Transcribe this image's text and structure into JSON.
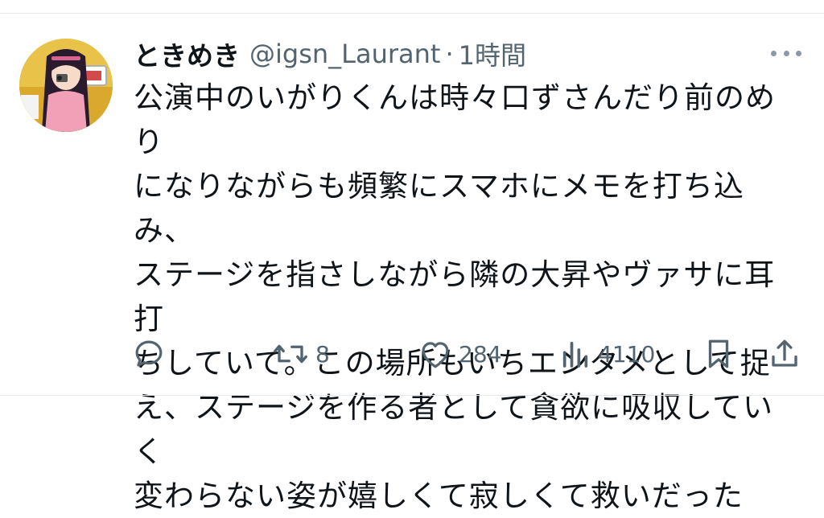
{
  "tweet": {
    "display_name": "ときめき",
    "handle": "@igsn_Laurant",
    "separator": "·",
    "timestamp": "1時間",
    "text": "公演中のいがりくんは時々口ずさんだり前のめり\nになりながらも頻繁にスマホにメモを打ち込み、\nステージを指さしながら隣の大昇やヴァサに耳打\nちしていて。この場所もいちエンタメとして捉\nえ、ステージを作る者として貪欲に吸収していく\n変わらない姿が嬉しくて寂しくて救いだった"
  },
  "actions": {
    "reply_icon": "reply-icon",
    "retweet_icon": "retweet-icon",
    "retweet_count": "8",
    "like_icon": "heart-icon",
    "like_count": "284",
    "views_icon": "views-icon",
    "views_count": "4110",
    "bookmark_icon": "bookmark-icon",
    "share_icon": "share-icon"
  },
  "colors": {
    "text": "#0f1419",
    "secondary": "#536471",
    "divider": "#e6e9eb",
    "avatar_bg": "#e9c24a"
  }
}
